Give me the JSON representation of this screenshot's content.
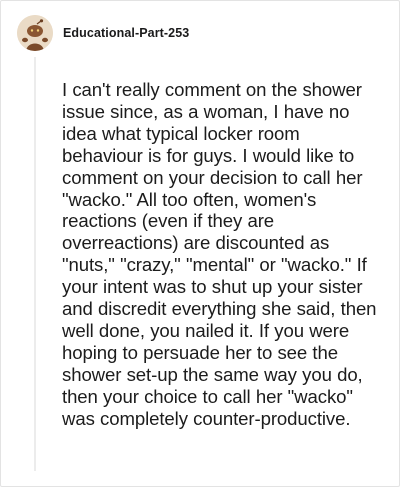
{
  "comment": {
    "username": "Educational-Part-253",
    "avatar_icon": "snoo-avatar-icon",
    "body": "I can't really comment on the shower issue since, as a woman, I have no idea what typical locker room behaviour is for guys. I would like to comment on your decision to call her \"wacko.\" All too often, women's reactions (even if they are overreactions) are discounted as \"nuts,\" \"crazy,\" \"mental\" or \"wacko.\" If your intent was to shut up your sister and discredit everything she said, then well done, you nailed it. If you were hoping to persuade her to see the shower set-up the same way you do, then your choice to call her \"wacko\" was completely counter-productive."
  },
  "colors": {
    "avatar_bg": "#e9dcc9",
    "avatar_figure": "#7a4a2a",
    "thread_line": "#ececec",
    "text": "#1c1c1c"
  }
}
